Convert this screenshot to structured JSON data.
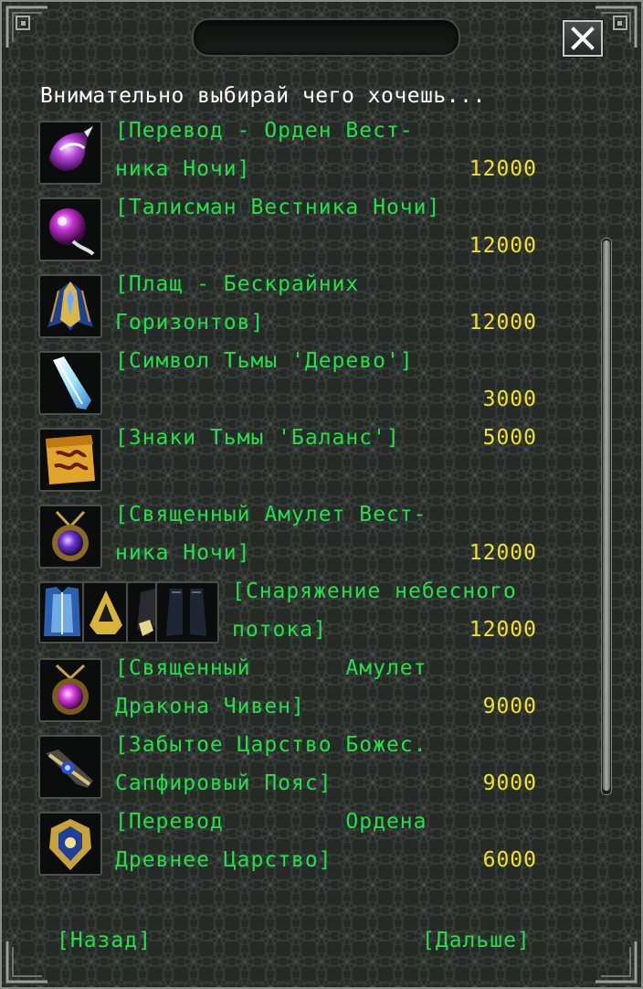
{
  "window": {
    "header": "Внимательно выбирай чего хочешь...",
    "close_icon": "close-icon"
  },
  "items": [
    {
      "name": "bird-order-icon",
      "line1": "[Перевод - Орден Вест-",
      "line2": "ника Ночи]",
      "price": "12000"
    },
    {
      "name": "talisman-icon",
      "line1": "[Талисман Вестника Ночи]",
      "line2": "",
      "price": "12000"
    },
    {
      "name": "cloak-icon",
      "line1": "[Плащ - Бескрайних",
      "line2": "Горизонтов]",
      "price": "12000"
    },
    {
      "name": "crystal-icon",
      "line1": "[Символ Тьмы 'Дерево']",
      "line2": "",
      "price": "3000"
    },
    {
      "name": "scroll-icon",
      "line1": "[Знаки Тьмы 'Баланс']",
      "line2": "",
      "price": "5000"
    },
    {
      "name": "amulet-icon",
      "line1": "[Священный Амулет Вест-",
      "line2": "ника Ночи]",
      "price": "12000"
    },
    {
      "name": "armor-set-icon",
      "line1": "[Снаряжение небесного",
      "line2": "потока]",
      "price": "12000"
    },
    {
      "name": "dragon-amulet-icon",
      "line1": "[Священный       Амулет",
      "line2": "Дракона Чивен]",
      "price": "9000"
    },
    {
      "name": "belt-icon",
      "line1": "[Забытое Царство Божес.",
      "line2": "Сапфировый Пояс]",
      "price": "9000"
    },
    {
      "name": "order-icon",
      "line1": "[Перевод         Ордена",
      "line2": "Древнее Царство]",
      "price": "6000"
    }
  ],
  "nav": {
    "back": "[Назад]",
    "next": "[Дальше]"
  },
  "colors": {
    "item_text": "#22e04a",
    "price_text": "#f2e41a",
    "header_text": "#ffffff"
  }
}
